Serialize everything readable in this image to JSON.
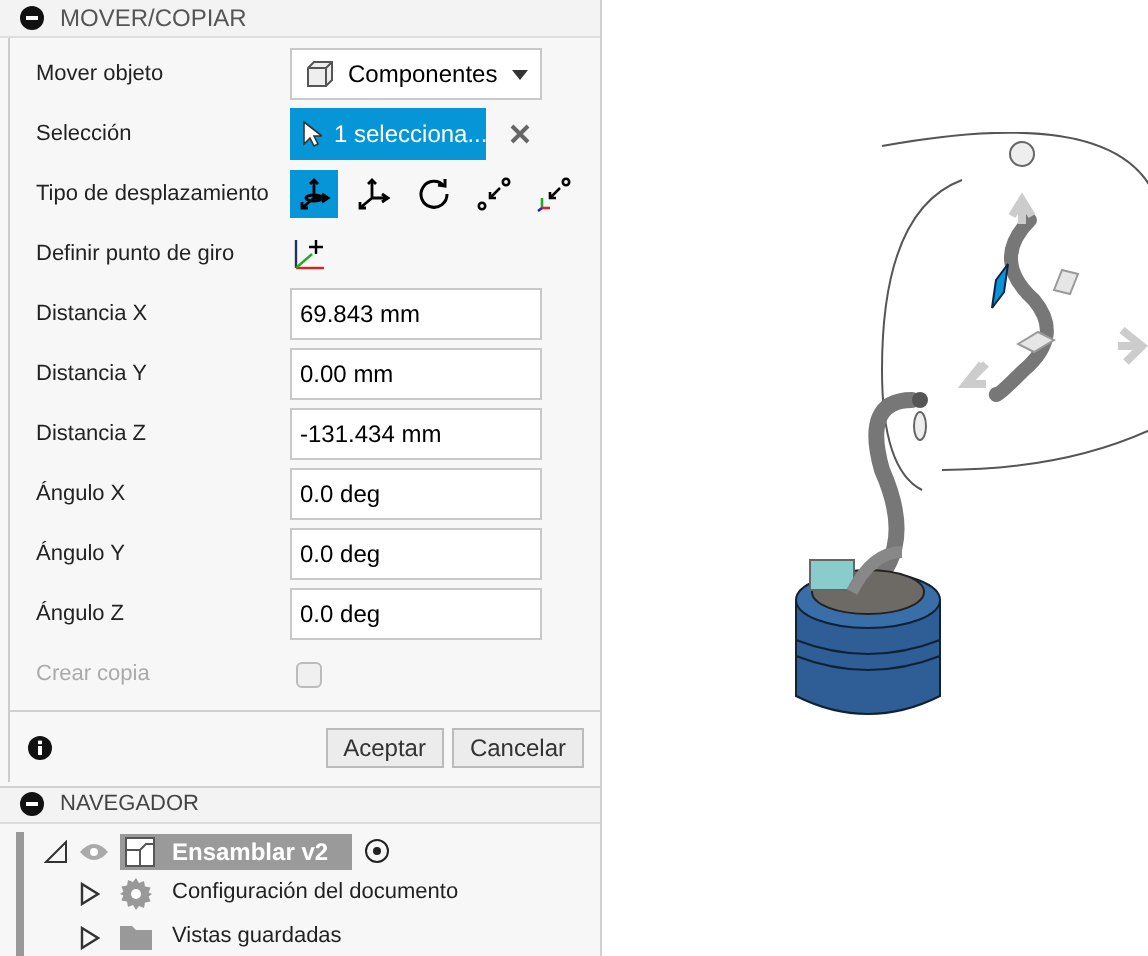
{
  "panel": {
    "title": "MOVER/COPIAR",
    "expanded": true
  },
  "rows": [
    {
      "kind": "select",
      "label": "Mover objeto",
      "value": "Componentes"
    },
    {
      "kind": "selection",
      "label": "Selección",
      "value": "1 selecciona..."
    },
    {
      "kind": "modes",
      "label": "Tipo de desplazamiento",
      "modes": [
        {
          "selected": true
        },
        {
          "selected": false
        },
        {
          "selected": false
        },
        {
          "selected": false
        },
        {
          "selected": false
        }
      ]
    },
    {
      "kind": "pivot",
      "label": "Definir punto de giro"
    },
    {
      "kind": "input",
      "label": "Distancia X",
      "value": "69.843 mm"
    },
    {
      "kind": "input",
      "label": "Distancia Y",
      "value": "0.00 mm"
    },
    {
      "kind": "input",
      "label": "Distancia Z",
      "value": "-131.434 mm"
    },
    {
      "kind": "input",
      "label": "Ángulo X",
      "value": "0.0 deg"
    },
    {
      "kind": "input",
      "label": "Ángulo Y",
      "value": "0.0 deg"
    },
    {
      "kind": "input",
      "label": "Ángulo Z",
      "value": "0.0 deg"
    },
    {
      "kind": "checkbox",
      "label": "Crear copia",
      "checked": false,
      "disabled": true
    }
  ],
  "buttons": [
    "Aceptar",
    "Cancelar"
  ],
  "navigator": {
    "title": "NAVEGADOR",
    "expanded": true,
    "root": {
      "label": "Ensamblar v2",
      "expanded": true,
      "visible": true
    },
    "items": [
      {
        "label": "Configuración del documento",
        "expanded": false
      },
      {
        "label": "Vistas guardadas",
        "expanded": false
      }
    ]
  }
}
